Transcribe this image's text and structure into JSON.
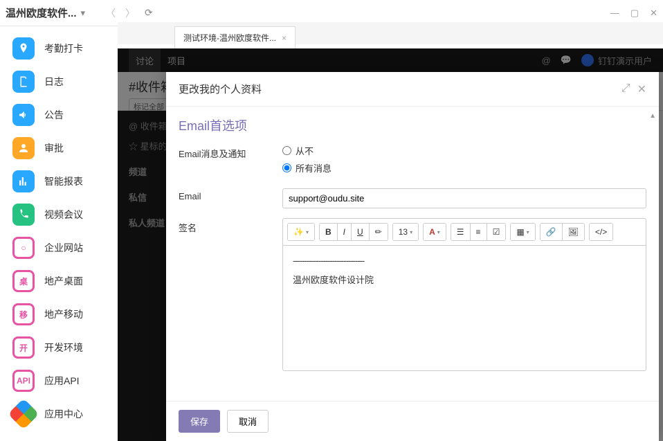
{
  "titlebar": {
    "title": "温州欧度软件..."
  },
  "tab": {
    "title": "测试环境-温州欧度软件..."
  },
  "sidebar": {
    "items": [
      {
        "label": "考勤打卡",
        "color": "#29a8ff",
        "icon": "pin"
      },
      {
        "label": "日志",
        "color": "#29a8ff",
        "icon": "doc"
      },
      {
        "label": "公告",
        "color": "#29a8ff",
        "icon": "horn"
      },
      {
        "label": "审批",
        "color": "#ffa726",
        "icon": "user"
      },
      {
        "label": "智能报表",
        "color": "#29a8ff",
        "icon": "chart"
      },
      {
        "label": "视频会议",
        "color": "#26c281",
        "icon": "phone"
      },
      {
        "label": "企业网站",
        "color": "#e754a4",
        "icon": "ring",
        "text": "○"
      },
      {
        "label": "地产桌面",
        "color": "#e754a4",
        "icon": "ring",
        "text": "桌"
      },
      {
        "label": "地产移动",
        "color": "#e754a4",
        "icon": "ring",
        "text": "移"
      },
      {
        "label": "开发环境",
        "color": "#e754a4",
        "icon": "ring",
        "text": "开"
      },
      {
        "label": "应用API",
        "color": "#e754a4",
        "icon": "ring",
        "text": "API"
      },
      {
        "label": "应用中心",
        "color": "multi",
        "icon": "appcenter"
      }
    ]
  },
  "appbar": {
    "tabs": [
      "讨论",
      "项目"
    ],
    "user": "钉钉演示用户"
  },
  "channel": {
    "title": "#收件箱",
    "mark_all": "标记全部",
    "inbox": "@ 收件箱",
    "starred": "☆ 星标的",
    "sections": [
      "频道",
      "私信",
      "私人频道"
    ]
  },
  "modal": {
    "title": "更改我的个人资料",
    "section": "Email首选项",
    "label_notify": "Email消息及通知",
    "radio_never": "从不",
    "radio_all": "所有消息",
    "label_email": "Email",
    "email_value": "support@oudu.site",
    "label_sign": "签名",
    "font_size": "13",
    "signature_text": "温州欧度软件设计院",
    "save": "保存",
    "cancel": "取消"
  }
}
